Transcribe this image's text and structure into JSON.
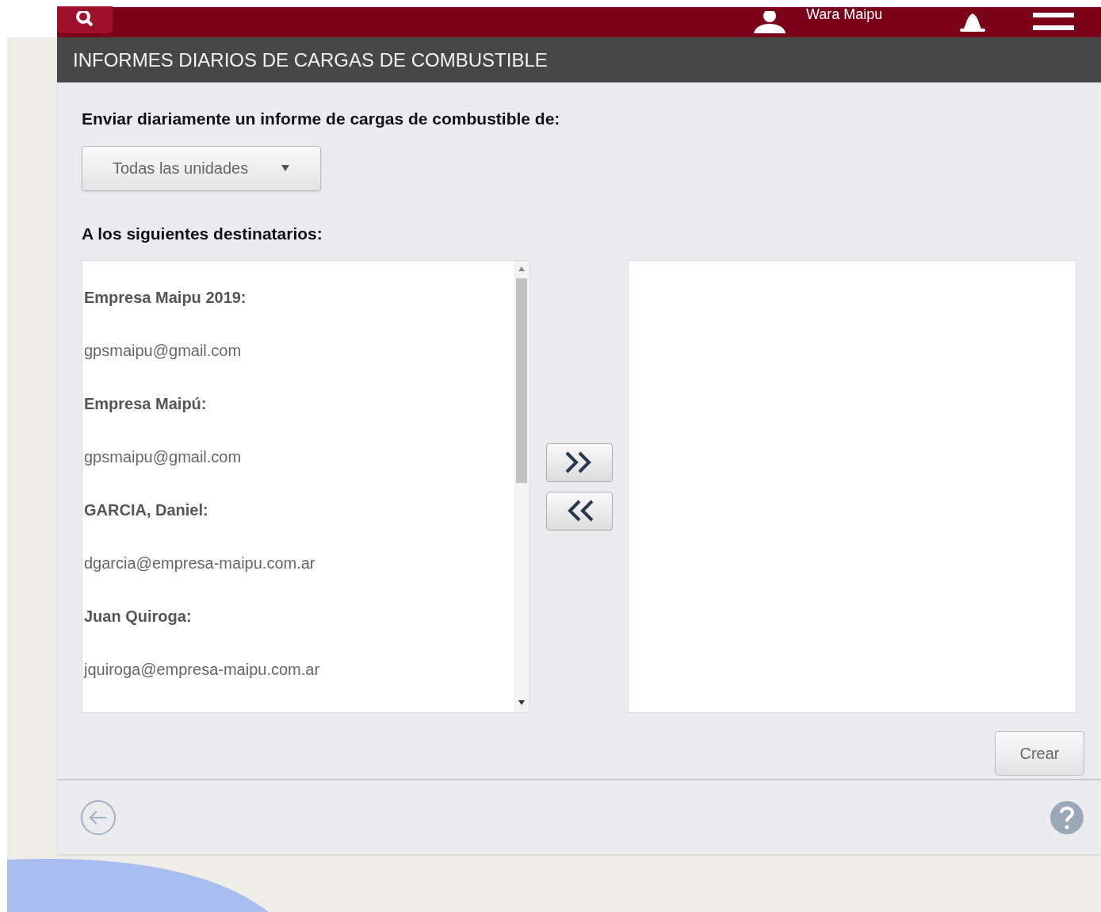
{
  "top_bar": {
    "user_name": "Wara Maipu"
  },
  "dialog": {
    "title": "INFORMES DIARIOS DE CARGAS DE COMBUSTIBLE",
    "units_label": "Enviar diariamente un informe de cargas de combustible de:",
    "units_select": {
      "value": "Todas las unidades"
    },
    "recipients_label": "A los siguientes destinatarios:",
    "available_recipients": [
      {
        "name": "Empresa Maipu 2019:",
        "email": "gpsmaipu@gmail.com"
      },
      {
        "name": "Empresa Maipú:",
        "email": "gpsmaipu@gmail.com"
      },
      {
        "name": "GARCIA, Daniel:",
        "email": "dgarcia@empresa-maipu.com.ar"
      },
      {
        "name": "Juan Quiroga:",
        "email": "jquiroga@empresa-maipu.com.ar"
      }
    ],
    "create_button": "Crear"
  }
}
